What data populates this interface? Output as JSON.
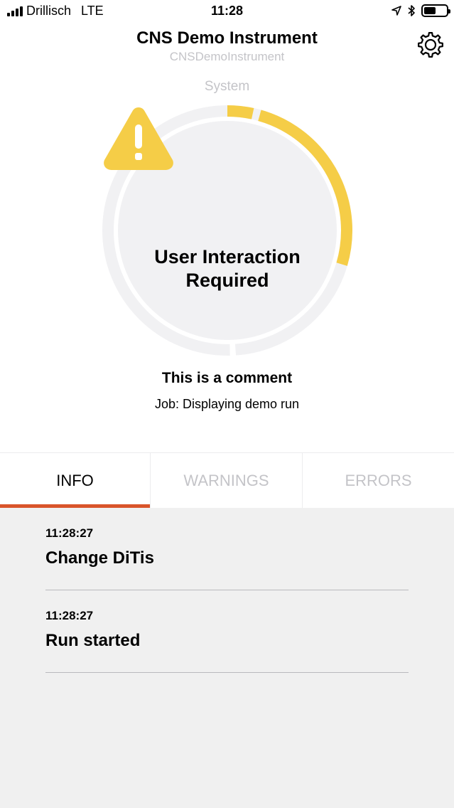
{
  "status_bar": {
    "carrier": "Drillisch",
    "network": "LTE",
    "time": "11:28"
  },
  "header": {
    "title": "CNS Demo Instrument",
    "subtitle": "CNSDemoInstrument",
    "settings_icon": "gear-icon"
  },
  "system": {
    "label": "System",
    "status": "User Interaction Required",
    "status_icon": "warning-triangle-icon",
    "accent_color": "#f5cd47"
  },
  "comment": "This is a comment",
  "job": {
    "prefix": "Job:",
    "value": "Displaying demo run"
  },
  "tabs": [
    {
      "label": "INFO",
      "active": true
    },
    {
      "label": "WARNINGS",
      "active": false
    },
    {
      "label": "ERRORS",
      "active": false
    }
  ],
  "tab_indicator_color": "#d9542a",
  "log_entries": [
    {
      "time": "11:28:27",
      "message": "Change DiTis"
    },
    {
      "time": "11:28:27",
      "message": "Run started"
    }
  ]
}
